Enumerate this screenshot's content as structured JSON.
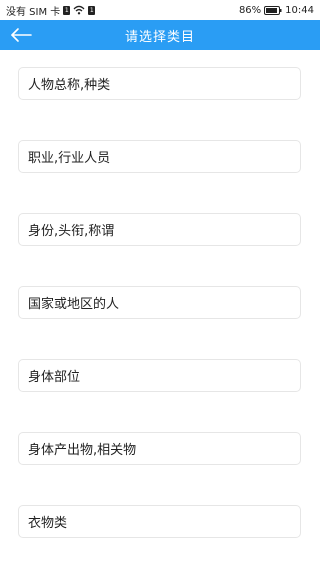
{
  "status_bar": {
    "carrier": "没有 SIM 卡",
    "battery_percent": "86%",
    "time": "10:44"
  },
  "app_bar": {
    "title": "请选择类目",
    "background_color": "#2a9df4"
  },
  "categories": [
    {
      "label": "人物总称,种类"
    },
    {
      "label": "职业,行业人员"
    },
    {
      "label": "身份,头衔,称谓"
    },
    {
      "label": "国家或地区的人"
    },
    {
      "label": "身体部位"
    },
    {
      "label": "身体产出物,相关物"
    },
    {
      "label": "衣物类"
    }
  ]
}
